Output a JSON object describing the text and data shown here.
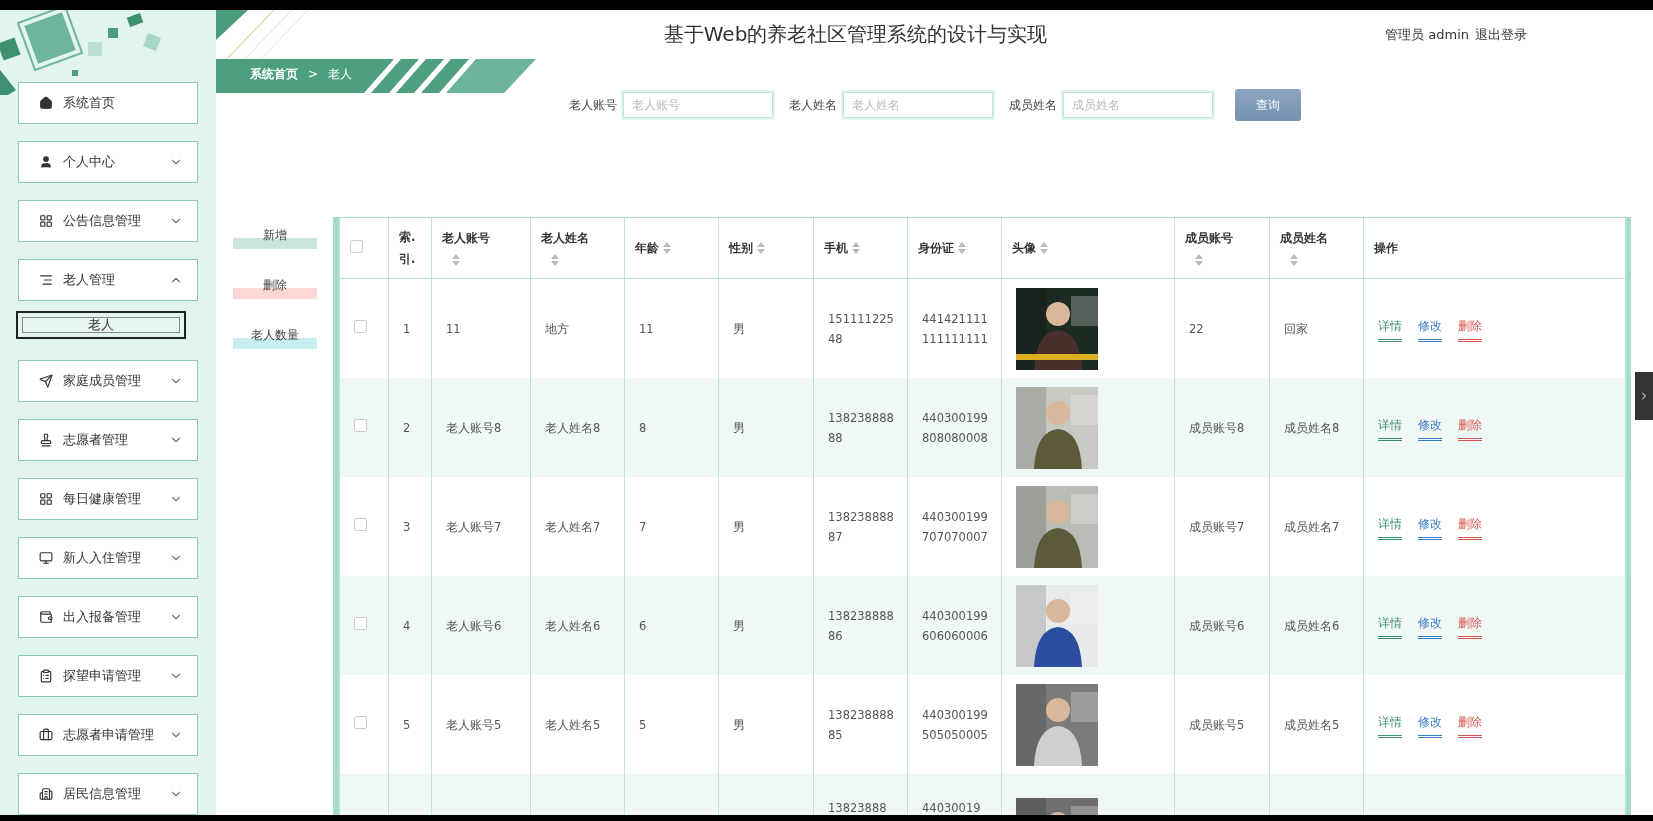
{
  "header": {
    "title": "基于Web的养老社区管理系统的设计与实现",
    "user_role": "管理员",
    "user_name": "admin",
    "logout": "退出登录"
  },
  "sidebar": {
    "items": [
      {
        "label": "系统首页",
        "kind": "link"
      },
      {
        "label": "个人中心",
        "kind": "group",
        "expanded": false
      },
      {
        "label": "公告信息管理",
        "kind": "group",
        "expanded": false
      },
      {
        "label": "老人管理",
        "kind": "group",
        "expanded": true,
        "children": [
          {
            "label": "老人",
            "selected": true
          }
        ]
      },
      {
        "label": "家庭成员管理",
        "kind": "group",
        "expanded": false
      },
      {
        "label": "志愿者管理",
        "kind": "group",
        "expanded": false
      },
      {
        "label": "每日健康管理",
        "kind": "group",
        "expanded": false
      },
      {
        "label": "新人入住管理",
        "kind": "group",
        "expanded": false
      },
      {
        "label": "出入报备管理",
        "kind": "group",
        "expanded": false
      },
      {
        "label": "探望申请管理",
        "kind": "group",
        "expanded": false
      },
      {
        "label": "志愿者申请管理",
        "kind": "group",
        "expanded": false
      },
      {
        "label": "居民信息管理",
        "kind": "group",
        "expanded": false
      }
    ]
  },
  "breadcrumb": [
    "系统首页",
    ">",
    "老人"
  ],
  "search": {
    "fields": [
      {
        "label": "老人账号",
        "placeholder": "老人账号"
      },
      {
        "label": "老人姓名",
        "placeholder": "老人姓名"
      },
      {
        "label": "成员姓名",
        "placeholder": "成员姓名"
      }
    ],
    "button": "查询"
  },
  "actions": [
    {
      "label": "新增",
      "kind": "add"
    },
    {
      "label": "删除",
      "kind": "delete"
    },
    {
      "label": "老人数量",
      "kind": "chart"
    }
  ],
  "table": {
    "select_all_checked": false,
    "columns": [
      {
        "label": "索.引.",
        "sortable": false
      },
      {
        "label": "老人账号",
        "sortable": true
      },
      {
        "label": "老人姓名",
        "sortable": true
      },
      {
        "label": "年龄",
        "sortable": true
      },
      {
        "label": "性别",
        "sortable": true
      },
      {
        "label": "手机",
        "sortable": true
      },
      {
        "label": "身份证",
        "sortable": true
      },
      {
        "label": "头像",
        "sortable": true
      },
      {
        "label": "成员账号",
        "sortable": true
      },
      {
        "label": "成员姓名",
        "sortable": true
      },
      {
        "label": "操作",
        "sortable": false
      }
    ],
    "rows": [
      {
        "checked": false,
        "cells": [
          "1",
          "11",
          "地方",
          "11",
          "男",
          "15111122548",
          "441421111111111111",
          "",
          "22",
          "回家"
        ],
        "avatar": {
          "kind": "picture"
        },
        "operations": [
          {
            "label": "详情",
            "kind": "detail"
          },
          {
            "label": "修改",
            "kind": "edit"
          },
          {
            "label": "删除",
            "kind": "delete"
          }
        ]
      },
      {
        "checked": false,
        "cells": [
          "2",
          "老人账号8",
          "老人姓名8",
          "8",
          "男",
          "13823888888",
          "440300199808080008",
          "",
          "成员账号8",
          "成员姓名8"
        ],
        "avatar": {
          "kind": "picture"
        },
        "operations": [
          {
            "label": "详情",
            "kind": "detail"
          },
          {
            "label": "修改",
            "kind": "edit"
          },
          {
            "label": "删除",
            "kind": "delete"
          }
        ]
      },
      {
        "checked": false,
        "cells": [
          "3",
          "老人账号7",
          "老人姓名7",
          "7",
          "男",
          "13823888887",
          "440300199707070007",
          "",
          "成员账号7",
          "成员姓名7"
        ],
        "avatar": {
          "kind": "picture"
        },
        "operations": [
          {
            "label": "详情",
            "kind": "detail"
          },
          {
            "label": "修改",
            "kind": "edit"
          },
          {
            "label": "删除",
            "kind": "delete"
          }
        ]
      },
      {
        "checked": false,
        "cells": [
          "4",
          "老人账号6",
          "老人姓名6",
          "6",
          "男",
          "13823888886",
          "440300199606060006",
          "",
          "成员账号6",
          "成员姓名6"
        ],
        "avatar": {
          "kind": "picture"
        },
        "operations": [
          {
            "label": "详情",
            "kind": "detail"
          },
          {
            "label": "修改",
            "kind": "edit"
          },
          {
            "label": "删除",
            "kind": "delete"
          }
        ]
      },
      {
        "checked": false,
        "cells": [
          "5",
          "老人账号5",
          "老人姓名5",
          "5",
          "男",
          "13823888885",
          "440300199505050005",
          "",
          "成员账号5",
          "成员姓名5"
        ],
        "avatar": {
          "kind": "picture"
        },
        "operations": [
          {
            "label": "详情",
            "kind": "detail"
          },
          {
            "label": "修改",
            "kind": "edit"
          },
          {
            "label": "删除",
            "kind": "delete"
          }
        ]
      },
      {
        "cells": [
          "",
          "",
          "",
          "",
          "",
          "13823888",
          "44030019",
          "",
          "",
          ""
        ],
        "avatar": {
          "kind": "picture"
        },
        "operations": []
      }
    ]
  }
}
